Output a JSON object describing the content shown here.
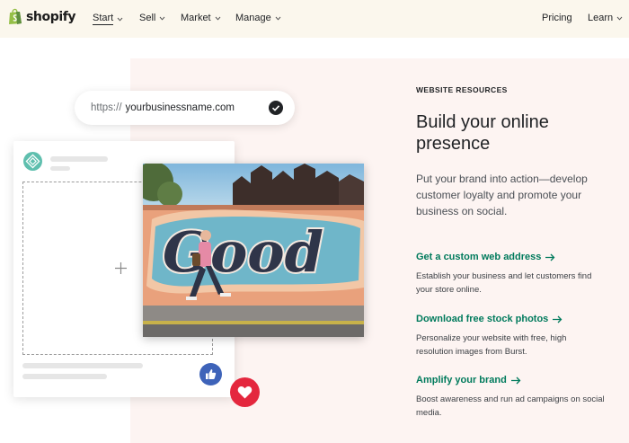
{
  "header": {
    "logo_text": "shopify",
    "nav": [
      {
        "label": "Start"
      },
      {
        "label": "Sell"
      },
      {
        "label": "Market"
      },
      {
        "label": "Manage"
      }
    ],
    "pricing": "Pricing",
    "learn": "Learn"
  },
  "illustration": {
    "url_prefix": "https://",
    "url_domain": "yourbusinessname.com",
    "photo_word": "Good"
  },
  "content": {
    "eyebrow": "WEBSITE RESOURCES",
    "headline": "Build your online presence",
    "intro": "Put your brand into action—develop customer loyalty and promote your business on social.",
    "resources": [
      {
        "link": "Get a custom web address",
        "desc": "Establish your business and let customers find your store online."
      },
      {
        "link": "Download free stock photos",
        "desc": "Personalize your website with free, high resolution images from Burst."
      },
      {
        "link": "Amplify your brand",
        "desc": "Boost awareness and run ad campaigns on social media."
      }
    ]
  },
  "colors": {
    "topbar": "#fbf7ed",
    "panel": "#fdf4f2",
    "link_green": "#007a5c",
    "like_blue": "#3e63b9",
    "heart_red": "#e4273e"
  },
  "icons": [
    "shopify-bag-icon",
    "chevron-down-icon",
    "check-circle-icon",
    "store-logo-icon",
    "plus-icon",
    "thumbs-up-icon",
    "heart-icon",
    "arrow-right-icon"
  ]
}
